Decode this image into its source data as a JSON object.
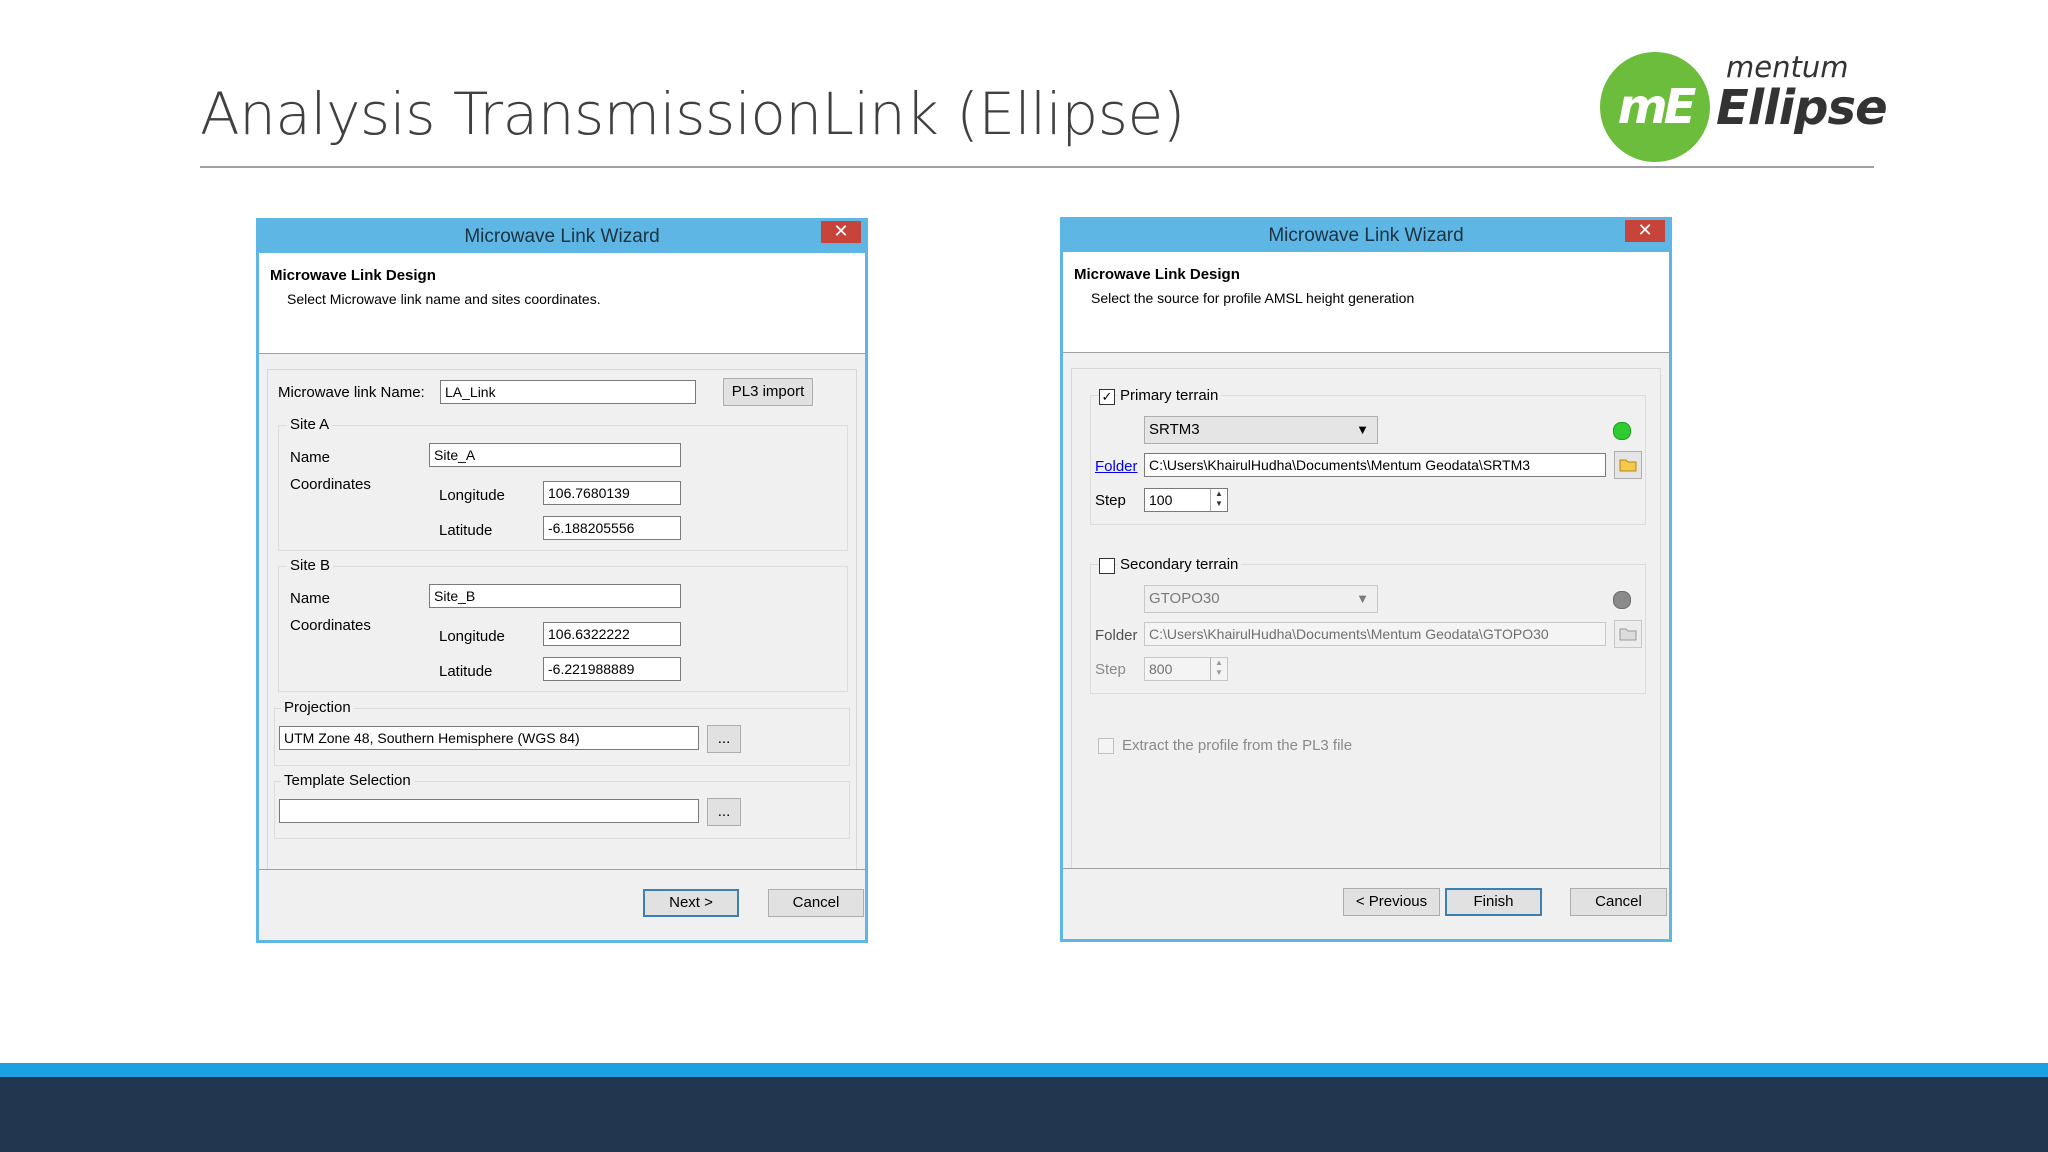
{
  "slide": {
    "title": "Analysis TransmissionLink (Ellipse)",
    "logo": {
      "mark": "mE",
      "brand_small": "mentum",
      "brand_large": "Ellipse"
    }
  },
  "colors": {
    "titlebar": "#5db6e3",
    "close": "#c7443a",
    "logo_green": "#6cbd3c",
    "band_light": "#1ba1e2",
    "band_dark": "#223650",
    "status_ok": "#2ecc2e",
    "status_off": "#8a8a8a"
  },
  "dialog1": {
    "title": "Microwave Link Wizard",
    "close": "✕",
    "header_title": "Microwave Link Design",
    "header_desc": "Select Microwave link name and sites coordinates.",
    "link_name_label": "Microwave link Name:",
    "link_name_value": "LA_Link",
    "pl3_button": "PL3 import",
    "site_a": {
      "legend": "Site A",
      "name_label": "Name",
      "name_value": "Site_A",
      "coords_label": "Coordinates",
      "lon_label": "Longitude",
      "lon_value": "106.7680139",
      "lat_label": "Latitude",
      "lat_value": "-6.188205556"
    },
    "site_b": {
      "legend": "Site B",
      "name_label": "Name",
      "name_value": "Site_B",
      "coords_label": "Coordinates",
      "lon_label": "Longitude",
      "lon_value": "106.6322222",
      "lat_label": "Latitude",
      "lat_value": "-6.221988889"
    },
    "projection": {
      "legend": "Projection",
      "value": "UTM Zone 48, Southern Hemisphere (WGS 84)",
      "browse": "..."
    },
    "template": {
      "legend": "Template Selection",
      "value": "",
      "browse": "..."
    },
    "next_button": "Next >",
    "cancel_button": "Cancel"
  },
  "dialog2": {
    "title": "Microwave Link Wizard",
    "close": "✕",
    "header_title": "Microwave Link Design",
    "header_desc": "Select the source for profile AMSL height generation",
    "primary": {
      "label": "Primary terrain",
      "checked": true,
      "check_mark": "✓",
      "source": "SRTM3",
      "folder_label": "Folder",
      "folder_value": "C:\\Users\\KhairulHudha\\Documents\\Mentum Geodata\\SRTM3",
      "step_label": "Step",
      "step_value": "100"
    },
    "secondary": {
      "label": "Secondary terrain",
      "checked": false,
      "source": "GTOPO30",
      "folder_label": "Folder",
      "folder_value": "C:\\Users\\KhairulHudha\\Documents\\Mentum Geodata\\GTOPO30",
      "step_label": "Step",
      "step_value": "800"
    },
    "extract_label": "Extract the profile from the PL3 file",
    "previous_button": "< Previous",
    "finish_button": "Finish",
    "cancel_button": "Cancel"
  }
}
